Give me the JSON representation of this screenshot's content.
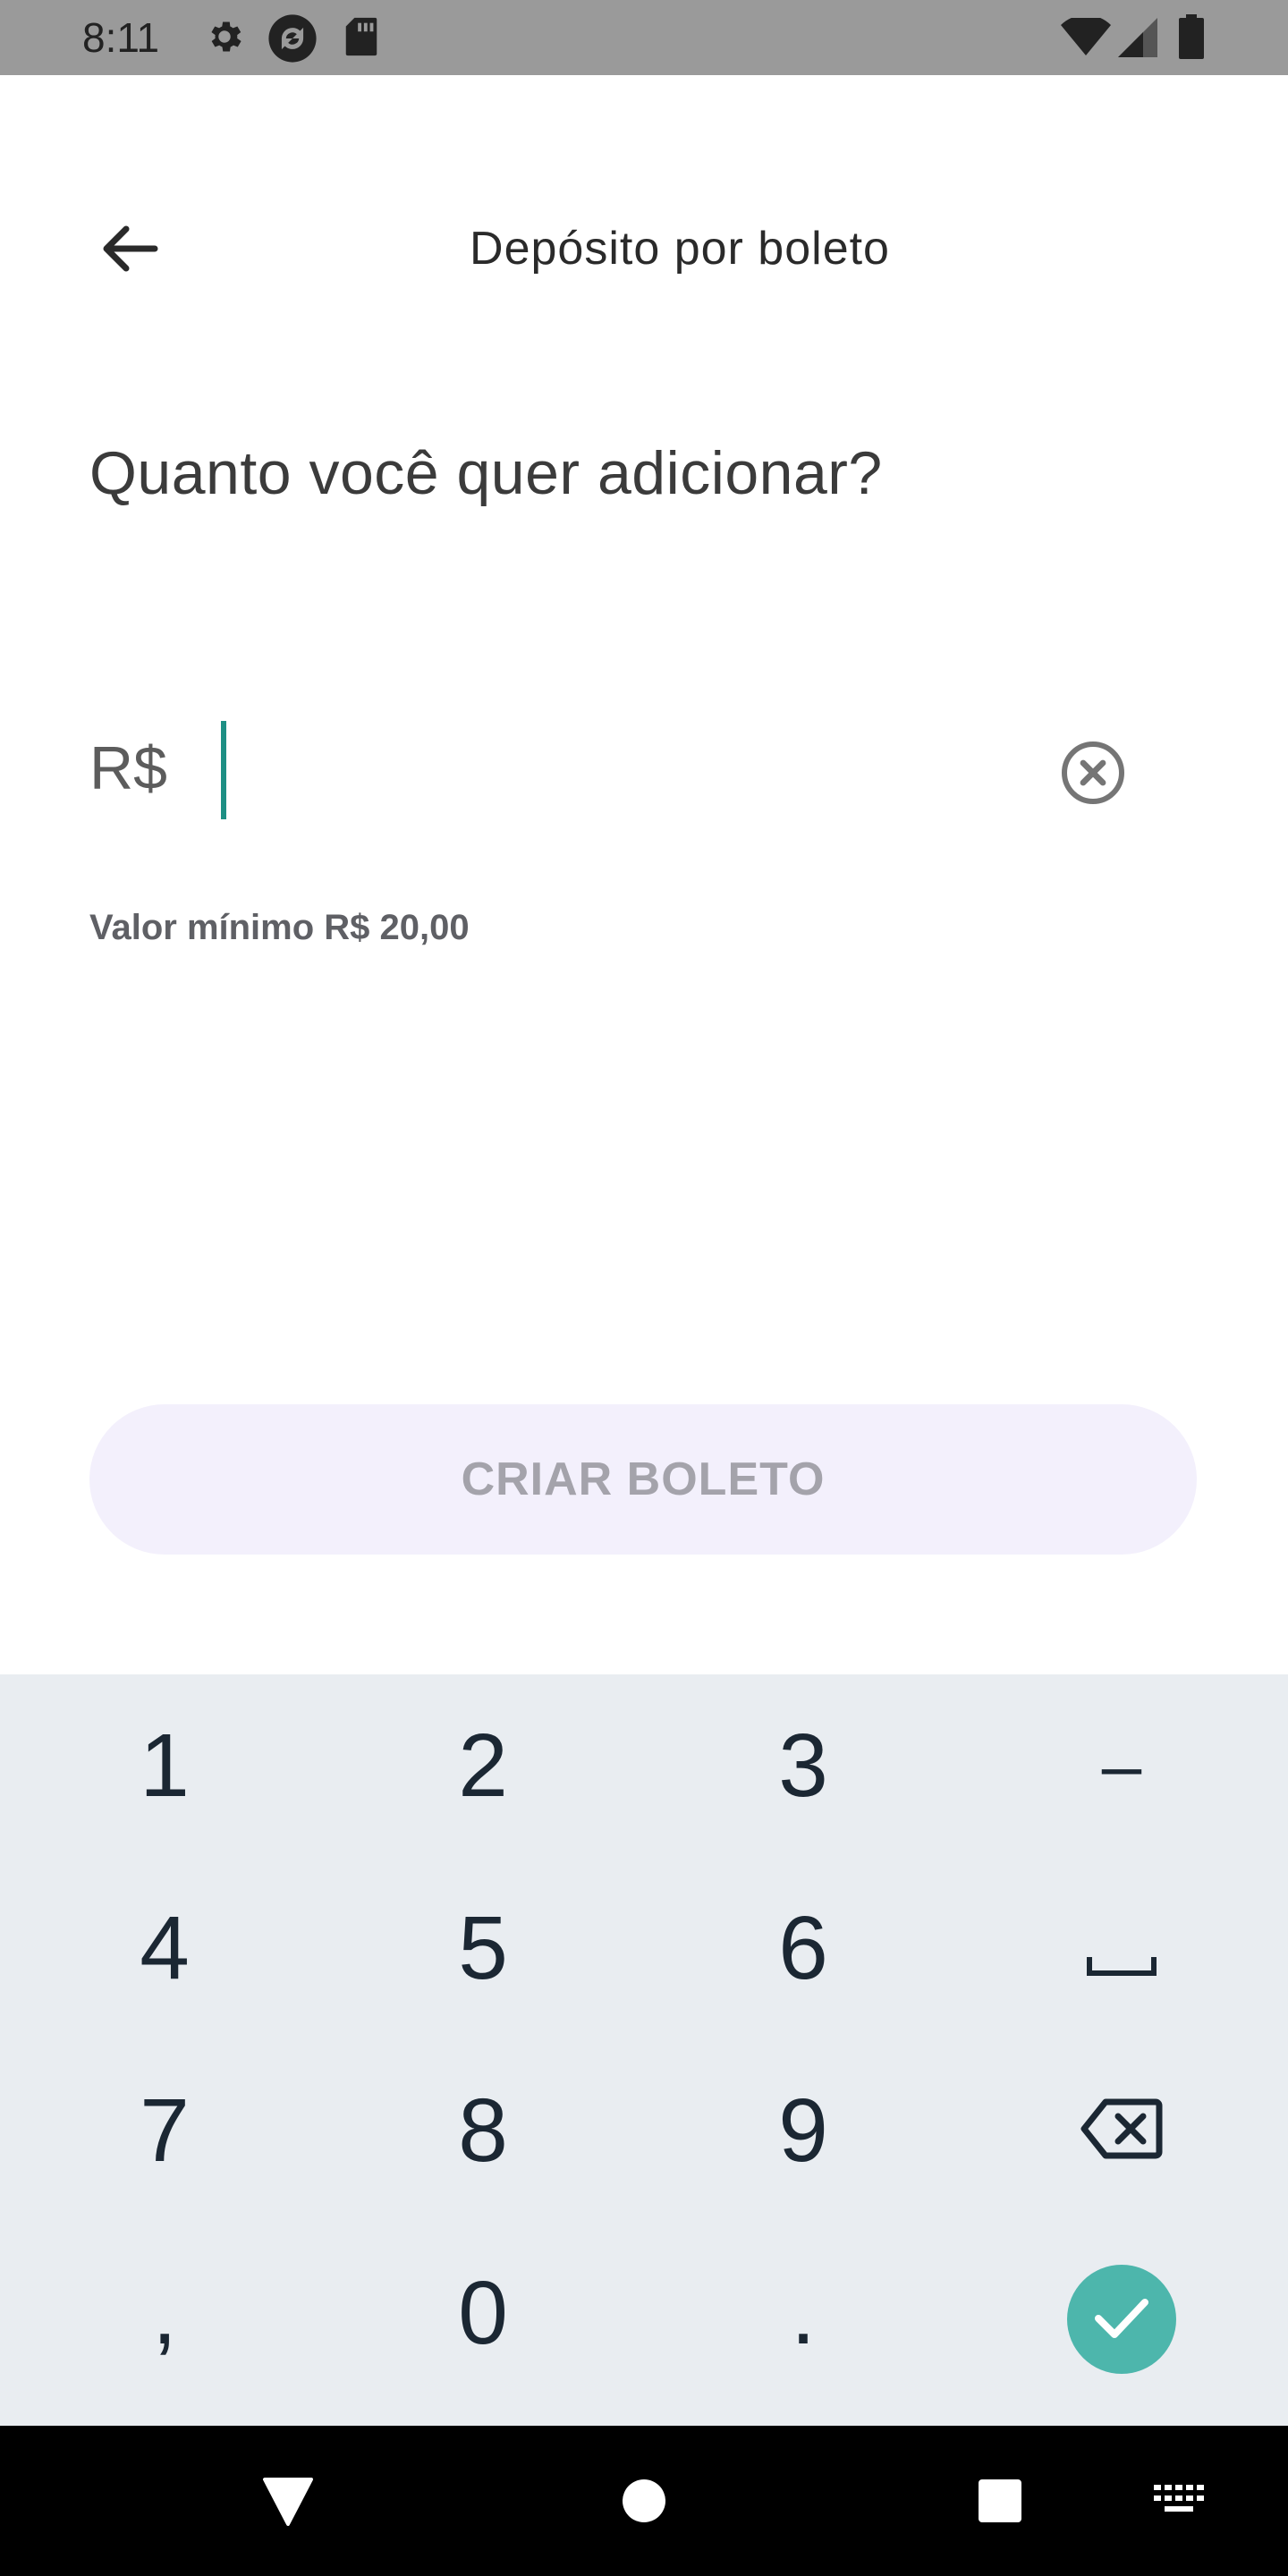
{
  "status_bar": {
    "time": "8:11",
    "icons": [
      "gear-icon",
      "sync-icon",
      "sd-card-icon",
      "wifi-icon",
      "signal-icon",
      "battery-icon"
    ]
  },
  "header": {
    "title": "Depósito por boleto",
    "back_icon": "arrow-back-icon"
  },
  "form": {
    "question": "Quanto você quer adicionar?",
    "currency": "R$",
    "amount_value": "",
    "clear_icon": "clear-circle-icon",
    "hint": "Valor mínimo R$ 20,00"
  },
  "primary_button": {
    "label": "CRIAR BOLETO",
    "enabled": false
  },
  "keyboard": {
    "row1": [
      "1",
      "2",
      "3",
      "–"
    ],
    "row2": [
      "4",
      "5",
      "6"
    ],
    "row3": [
      "7",
      "8",
      "9"
    ],
    "row4": [
      ",",
      "0",
      "."
    ],
    "space_icon": "space-bar-icon",
    "backspace_icon": "backspace-icon",
    "done_icon": "check-icon"
  },
  "colors": {
    "accent": "#4db6ac",
    "caret": "#1d8f84",
    "button_bg": "#f3f0fc",
    "keyboard_bg": "#e9edf1"
  },
  "nav_bar": {
    "icons": [
      "back-triangle-icon",
      "home-circle-icon",
      "recents-square-icon",
      "keyboard-switch-icon"
    ]
  }
}
